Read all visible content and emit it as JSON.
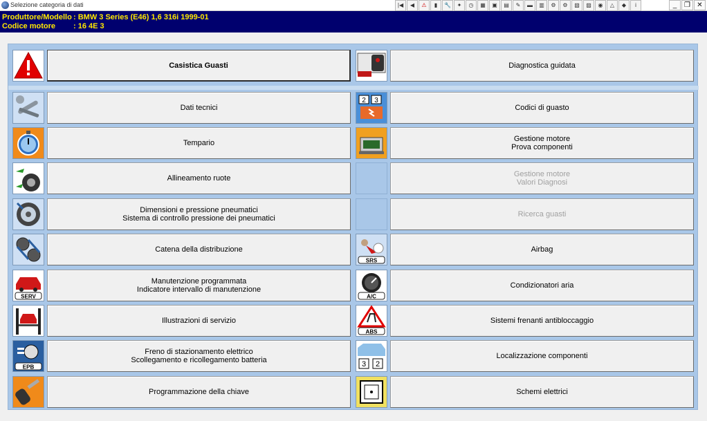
{
  "window": {
    "title": "Selezione categoria di dati",
    "controls": {
      "minimize": "_",
      "restore": "❐",
      "close": "✕"
    }
  },
  "toolbar": {
    "buttons": [
      {
        "name": "first-icon",
        "glyph": "|◀"
      },
      {
        "name": "back-icon",
        "glyph": "◀"
      },
      {
        "name": "warning-icon",
        "glyph": "⚠",
        "color": "#d00000"
      },
      {
        "name": "component-icon",
        "glyph": "▮"
      },
      {
        "name": "wrench-icon",
        "glyph": "🔧"
      },
      {
        "name": "key-icon",
        "glyph": "✦"
      },
      {
        "name": "clock-icon",
        "glyph": "◷"
      },
      {
        "name": "fault-codes-icon",
        "glyph": "▦"
      },
      {
        "name": "service-icon",
        "glyph": "▣"
      },
      {
        "name": "lift-icon",
        "glyph": "▤"
      },
      {
        "name": "tools-icon",
        "glyph": "✎"
      },
      {
        "name": "car-icon",
        "glyph": "▬"
      },
      {
        "name": "print-icon",
        "glyph": "▥"
      },
      {
        "name": "gearbox-icon",
        "glyph": "⚙"
      },
      {
        "name": "settings-icon",
        "glyph": "⚙"
      },
      {
        "name": "diagram-icon",
        "glyph": "▧"
      },
      {
        "name": "doc-icon",
        "glyph": "▨"
      },
      {
        "name": "airbag-icon",
        "glyph": "◉"
      },
      {
        "name": "abs-icon",
        "glyph": "△"
      },
      {
        "name": "car-body-icon",
        "glyph": "◆"
      },
      {
        "name": "info-icon",
        "glyph": "i"
      }
    ]
  },
  "vehicle": {
    "make_model_label": "Produttore/Modello",
    "make_model_value": ": BMW   3 Series (E46) 1,6 316i 1999-01",
    "engine_code_label": "Codice motore",
    "engine_code_value": ": 16 4E 3"
  },
  "categories": {
    "left": [
      {
        "icon": "warning-triangle-icon",
        "lines": [
          "Casistica Guasti"
        ],
        "bold": true
      },
      {
        "icon": "wrench-tools-icon",
        "lines": [
          "Dati tecnici"
        ]
      },
      {
        "icon": "stopwatch-icon",
        "lines": [
          "Tempario"
        ]
      },
      {
        "icon": "wheel-alignment-icon",
        "lines": [
          "Allineamento ruote"
        ]
      },
      {
        "icon": "tire-pressure-icon",
        "lines": [
          "Dimensioni e pressione pneumatici",
          "Sistema di controllo pressione dei pneumatici"
        ]
      },
      {
        "icon": "timing-chain-icon",
        "lines": [
          "Catena della distribuzione"
        ]
      },
      {
        "icon": "service-car-icon",
        "lines": [
          "Manutenzione programmata",
          "Indicatore intervallo di manutenzione"
        ],
        "badge": "SERV"
      },
      {
        "icon": "car-lift-icon",
        "lines": [
          "Illustrazioni di servizio"
        ]
      },
      {
        "icon": "electric-parking-brake-icon",
        "lines": [
          "Freno di stazionamento elettrico",
          "Scollegamento e ricollegamento batteria"
        ],
        "badge": "EPB"
      },
      {
        "icon": "car-key-icon",
        "lines": [
          "Programmazione della chiave"
        ]
      }
    ],
    "right": [
      {
        "icon": "diagnostic-device-icon",
        "lines": [
          "Diagnostica guidata"
        ]
      },
      {
        "icon": "fault-codes-icon",
        "lines": [
          "Codici di guasto"
        ],
        "digits": [
          "2",
          "3"
        ]
      },
      {
        "icon": "engine-ecu-icon",
        "lines": [
          "Gestione motore",
          "Prova componenti"
        ]
      },
      {
        "icon": "empty-icon",
        "lines": [
          "Gestione motore",
          "Valori Diagnosi"
        ],
        "disabled": true
      },
      {
        "icon": "empty-icon",
        "lines": [
          "Ricerca guasti"
        ],
        "disabled": true
      },
      {
        "icon": "airbag-srs-icon",
        "lines": [
          "Airbag"
        ],
        "badge": "SRS"
      },
      {
        "icon": "air-conditioning-icon",
        "lines": [
          "Condizionatori aria"
        ],
        "badge": "A/C"
      },
      {
        "icon": "abs-warning-icon",
        "lines": [
          "Sistemi frenanti antibloccaggio"
        ],
        "badge": "ABS"
      },
      {
        "icon": "component-location-icon",
        "lines": [
          "Localizzazione componenti"
        ],
        "digits": [
          "3",
          "2"
        ]
      },
      {
        "icon": "wiring-diagram-icon",
        "lines": [
          "Schemi elettrici"
        ]
      }
    ]
  },
  "colors": {
    "title_bar_bg": "#00006e",
    "title_text": "#ffe800",
    "panel_bg": "#a9c7e8"
  }
}
